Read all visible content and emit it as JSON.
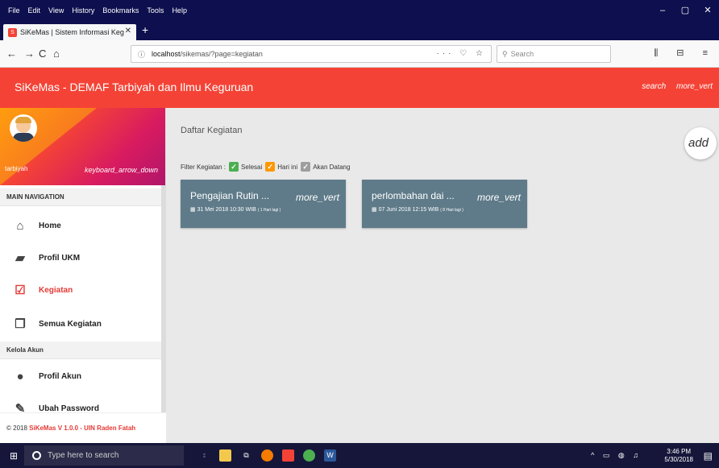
{
  "browser": {
    "menu": [
      "File",
      "Edit",
      "View",
      "History",
      "Bookmarks",
      "Tools",
      "Help"
    ],
    "window_controls": [
      "–",
      "▢",
      "✕"
    ],
    "tab_title": "SiKeMas | Sistem Informasi Keg",
    "tab_close": "✕",
    "new_tab": "+",
    "back": "←",
    "forward": "→",
    "reload": "C",
    "home": "⌂",
    "url_host": "localhost",
    "url_path": "/sikemas/?page=kegiatan",
    "url_actions": "··· ♡ ☆",
    "search_placeholder": "Search",
    "toolbar_icons": "⫼ ⊟ ≡"
  },
  "app": {
    "title": "SiKeMas - DEMAF Tarbiyah dan Ilmu Keguruan",
    "search_label": "search",
    "more_label": "more_vert"
  },
  "sidebar": {
    "user_name": "tarbiyah",
    "user_toggle": "keyboard_arrow_down",
    "main_nav_header": "MAIN NAVIGATION",
    "items": [
      {
        "label": "Home",
        "icon": "home-icon",
        "glyph": "⌂"
      },
      {
        "label": "Profil UKM",
        "icon": "book-icon",
        "glyph": "▰"
      },
      {
        "label": "Kegiatan",
        "icon": "calendar-check-icon",
        "glyph": "☑"
      },
      {
        "label": "Semua Kegiatan",
        "icon": "library-icon",
        "glyph": "❐"
      }
    ],
    "account_header": "Kelola Akun",
    "account_items": [
      {
        "label": "Profil Akun",
        "icon": "person-icon",
        "glyph": "●"
      },
      {
        "label": "Ubah Password",
        "icon": "edit-icon",
        "glyph": "✎"
      }
    ],
    "footer_prefix": "© 2018 ",
    "footer_brand": "SiKeMas V 1.0.0 - UIN Raden Fatah"
  },
  "content": {
    "heading": "Daftar Kegiatan",
    "fab_label": "add",
    "filter_label": "Filter Kegiatan :",
    "filters": [
      {
        "label": "Selesai",
        "color": "#4caf50"
      },
      {
        "label": "Hari ini",
        "color": "#ff9800"
      },
      {
        "label": "Akan Datang",
        "color": "#9e9e9e"
      }
    ],
    "cards": [
      {
        "title": "Pengajian Rutin ...",
        "more": "more_vert",
        "date": "31 Mei 2018  10:30 WIB",
        "relative": "( 1 Hari lagi )"
      },
      {
        "title": "perlombahan dai ...",
        "more": "more_vert",
        "date": "07 Juni 2018  12:15 WIB",
        "relative": "( 8 Hari lagi )"
      }
    ]
  },
  "taskbar": {
    "search_placeholder": "Type here to search",
    "time": "3:46 PM",
    "date": "5/30/2018"
  },
  "colors": {
    "accent": "#f44336",
    "card": "#5f7b89",
    "menubar": "#0d0f4e"
  }
}
